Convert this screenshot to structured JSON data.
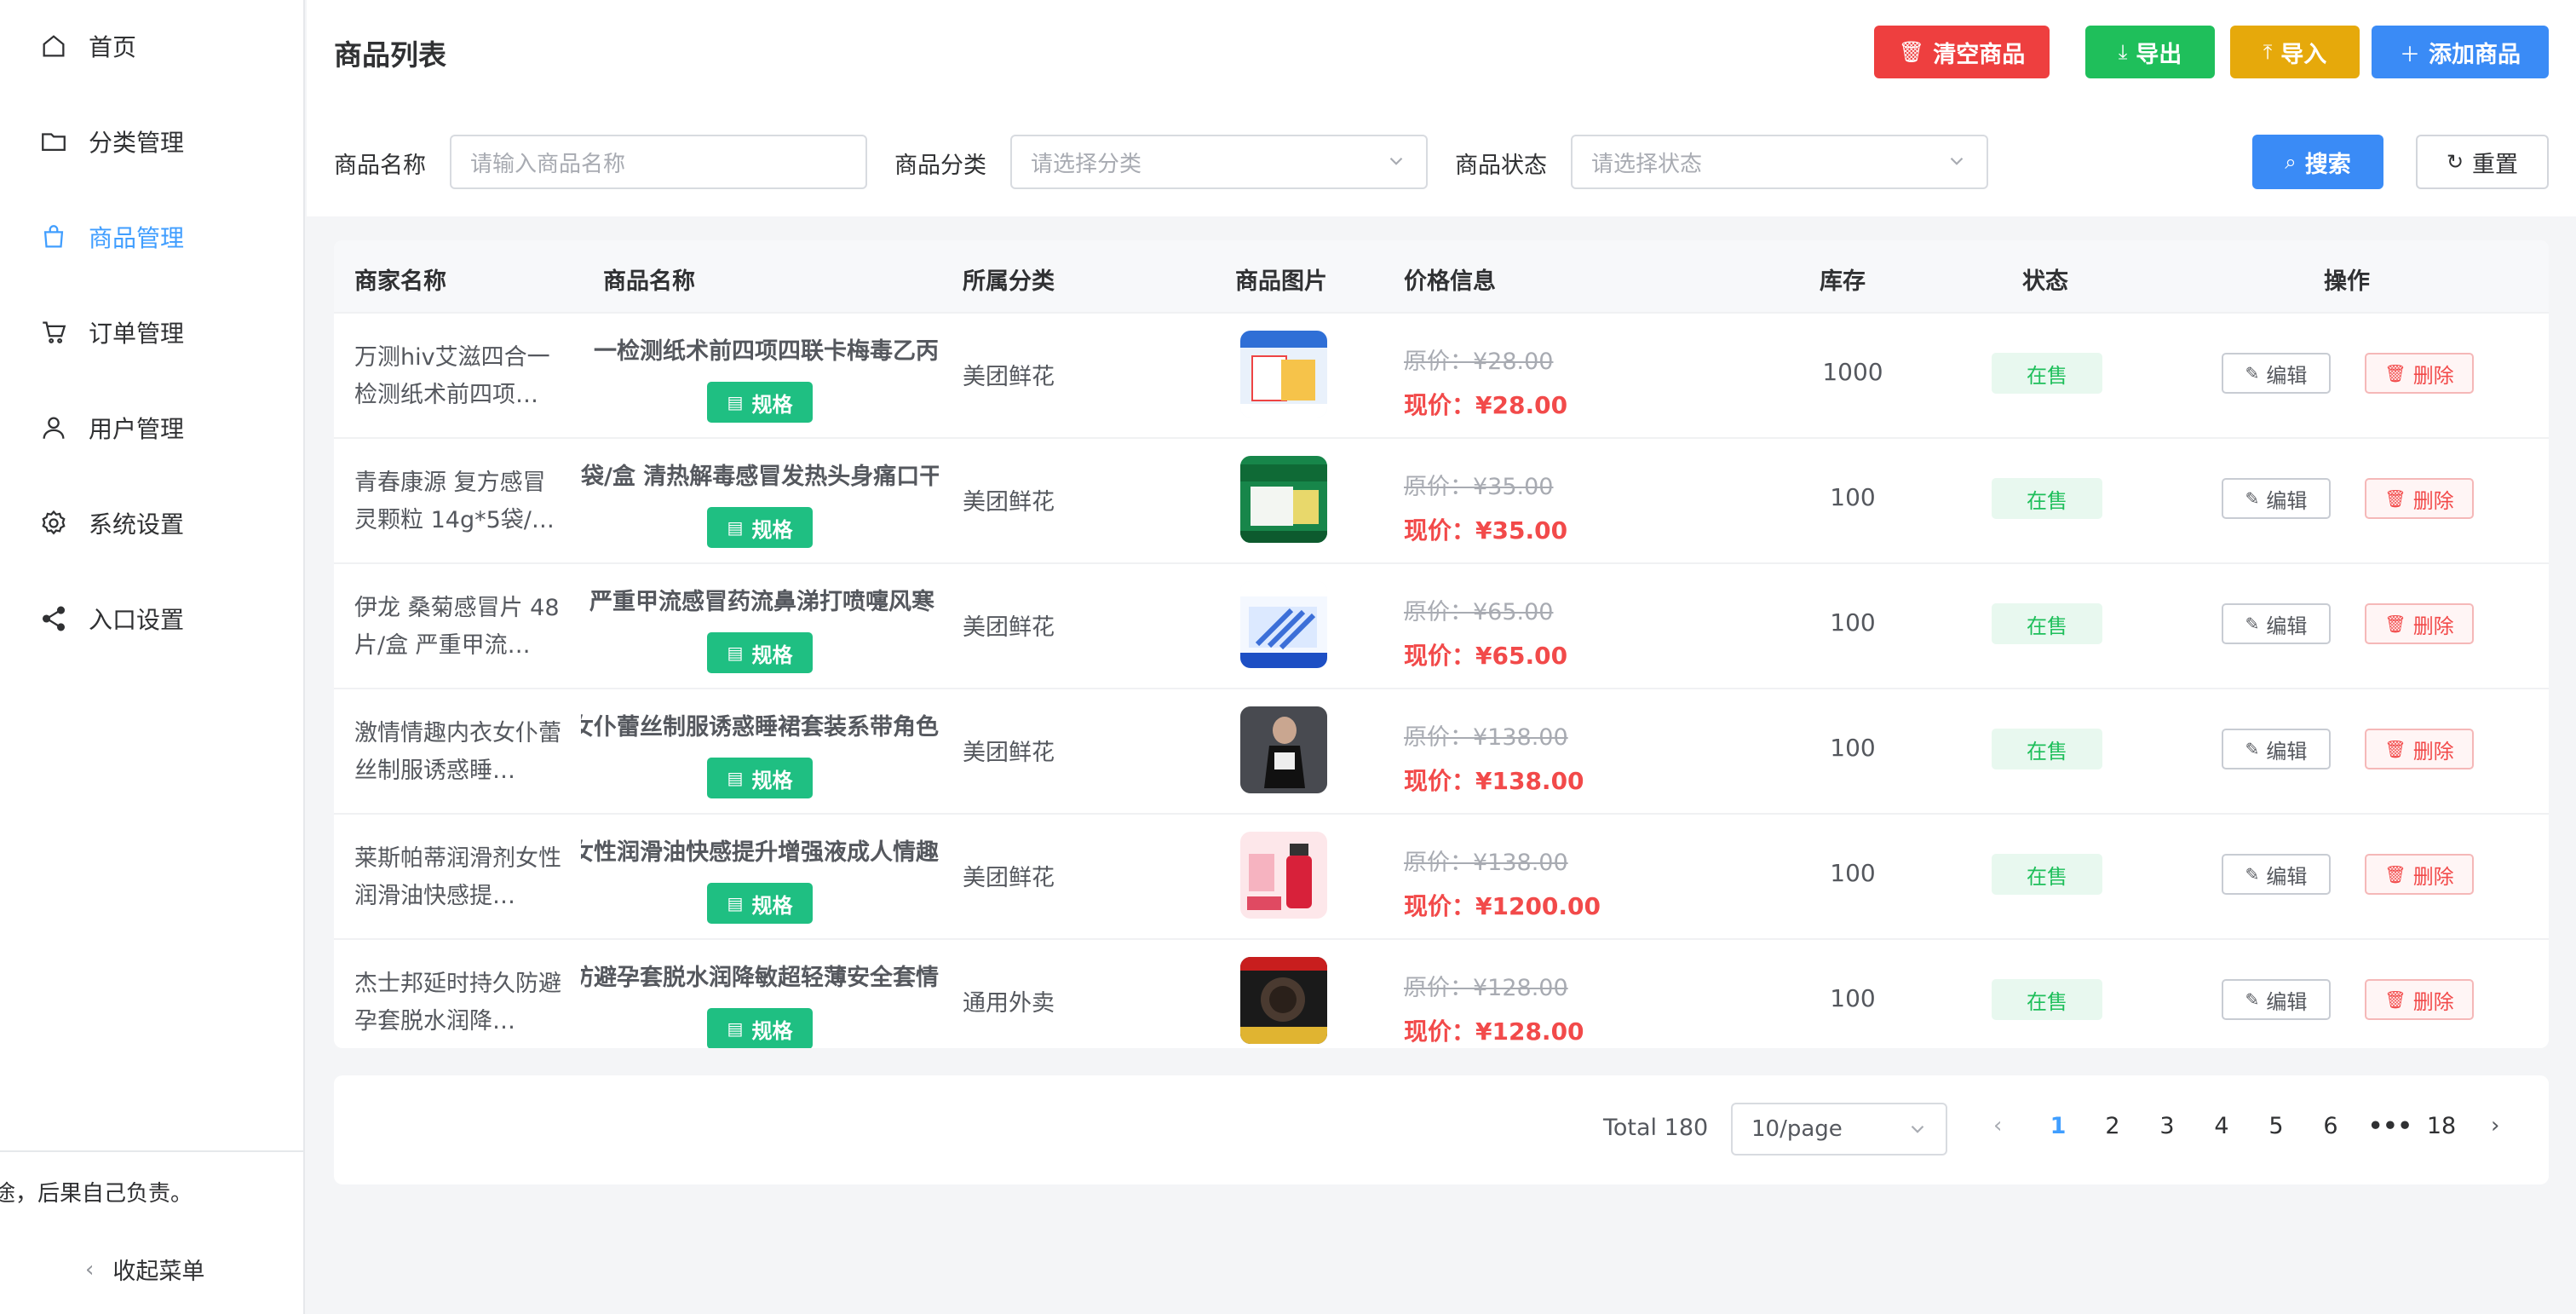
{
  "sidebar": {
    "items": [
      {
        "label": "首页",
        "icon": "home-icon"
      },
      {
        "label": "分类管理",
        "icon": "folder-icon"
      },
      {
        "label": "商品管理",
        "icon": "shopping-bag-icon",
        "active": true
      },
      {
        "label": "订单管理",
        "icon": "cart-icon"
      },
      {
        "label": "用户管理",
        "icon": "user-icon"
      },
      {
        "label": "系统设置",
        "icon": "gear-icon"
      },
      {
        "label": "入口设置",
        "icon": "share-icon"
      }
    ],
    "notice": "途，后果自己负责。",
    "collapse_label": "收起菜单"
  },
  "header": {
    "title": "商品列表",
    "buttons": {
      "clear": "清空商品",
      "export": "导出",
      "import": "导入",
      "add": "添加商品"
    }
  },
  "filters": {
    "name_label": "商品名称",
    "name_placeholder": "请输入商品名称",
    "category_label": "商品分类",
    "category_placeholder": "请选择分类",
    "status_label": "商品状态",
    "status_placeholder": "请选择状态",
    "search": "搜索",
    "reset": "重置"
  },
  "table": {
    "columns": [
      "商家名称",
      "商品名称",
      "所属分类",
      "商品图片",
      "价格信息",
      "库存",
      "状态",
      "操作"
    ],
    "spec_label": "规格",
    "edit_label": "编辑",
    "delete_label": "删除",
    "rows": [
      {
        "merchant": "万测hiv艾滋四合一检测纸术前四项…",
        "product": "一检测纸术前四项四联卡梅毒乙丙",
        "category": "美团鲜花",
        "price_old": "原价：¥28.00",
        "price_new": "现价：¥28.00",
        "stock": "1000",
        "status": "在售"
      },
      {
        "merchant": "青春康源 复方感冒灵颗粒 14g*5袋/…",
        "product": "袋/盒 清热解毒感冒发热头身痛口干",
        "category": "美团鲜花",
        "price_old": "原价：¥35.00",
        "price_new": "现价：¥35.00",
        "stock": "100",
        "status": "在售"
      },
      {
        "merchant": "伊龙 桑菊感冒片 48片/盒 严重甲流…",
        "product": "严重甲流感冒药流鼻涕打喷嚏风寒",
        "category": "美团鲜花",
        "price_old": "原价：¥65.00",
        "price_new": "现价：¥65.00",
        "stock": "100",
        "status": "在售"
      },
      {
        "merchant": "激情情趣内衣女仆蕾丝制服诱惑睡…",
        "product": "女仆蕾丝制服诱惑睡裙套装系带角色",
        "category": "美团鲜花",
        "price_old": "原价：¥138.00",
        "price_new": "现价：¥138.00",
        "stock": "100",
        "status": "在售"
      },
      {
        "merchant": "莱斯帕蒂润滑剂女性润滑油快感提…",
        "product": "女性润滑油快感提升增强液成人情趣",
        "category": "美团鲜花",
        "price_old": "原价：¥138.00",
        "price_new": "现价：¥1200.00",
        "stock": "100",
        "status": "在售"
      },
      {
        "merchant": "杰士邦延时持久防避孕套脱水润降…",
        "product": "防避孕套脱水润降敏超轻薄安全套情",
        "category": "通用外卖",
        "price_old": "原价：¥128.00",
        "price_new": "现价：¥128.00",
        "stock": "100",
        "status": "在售"
      }
    ]
  },
  "pagination": {
    "total": "Total 180",
    "page_size": "10/page",
    "pages": [
      "1",
      "2",
      "3",
      "4",
      "5",
      "6",
      "•••",
      "18"
    ],
    "current": "1"
  },
  "colors": {
    "accent": "#409eff",
    "danger": "#ee3f3f",
    "success": "#1fbf5b",
    "warning": "#e6a90b",
    "primary": "#3a8bf6"
  }
}
